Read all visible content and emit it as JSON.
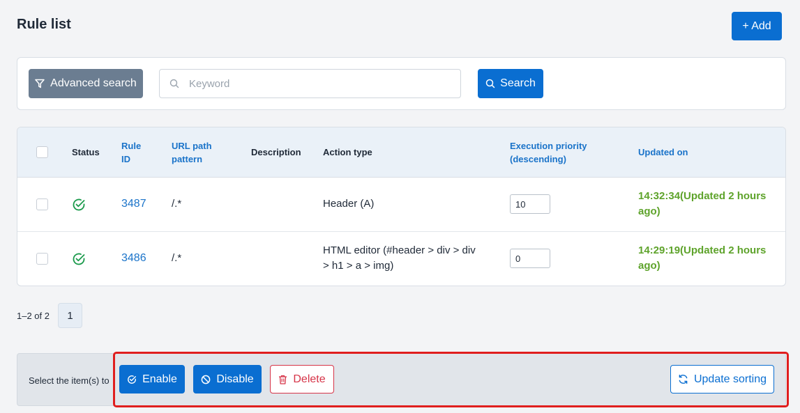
{
  "header": {
    "title": "Rule list",
    "add_label": "+ Add"
  },
  "search": {
    "advanced_label": "Advanced search",
    "keyword_placeholder": "Keyword",
    "keyword_value": "",
    "search_label": "Search"
  },
  "table": {
    "columns": {
      "status": "Status",
      "rule_id_line1": "Rule",
      "rule_id_line2": "ID",
      "url_line1": "URL path",
      "url_line2": "pattern",
      "description": "Description",
      "action_type": "Action type",
      "priority_line1": "Execution priority",
      "priority_line2": "(descending)",
      "updated_on": "Updated on"
    },
    "rows": [
      {
        "rule_id": "3487",
        "url_pattern": "/.*",
        "description": "",
        "action_line1": "Header (A)",
        "action_line2": "",
        "priority": "10",
        "updated_line1": "14:32:34(Updated 2 hours",
        "updated_line2": "ago)",
        "status_icon": "check-circle-icon"
      },
      {
        "rule_id": "3486",
        "url_pattern": "/.*",
        "description": "",
        "action_line1": "HTML editor (#header > div > div",
        "action_line2": "> h1 > a > img)",
        "priority": "0",
        "updated_line1": "14:29:19(Updated 2 hours",
        "updated_line2": "ago)",
        "status_icon": "check-circle-icon"
      }
    ]
  },
  "pagination": {
    "range_text": "1–2 of 2",
    "current_page": "1"
  },
  "bulk_actions": {
    "label": "Select the item(s) to",
    "enable_label": "Enable",
    "disable_label": "Disable",
    "delete_label": "Delete",
    "update_sorting_label": "Update sorting"
  },
  "colors": {
    "primary": "#0a6ed1",
    "success": "#5ea32b",
    "danger": "#d63347",
    "highlight": "#e01e1e"
  }
}
